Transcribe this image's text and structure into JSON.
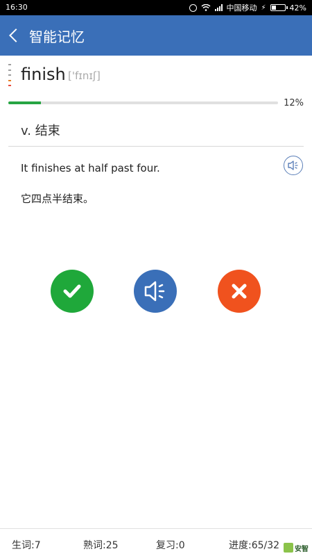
{
  "status_bar": {
    "time": "16:30",
    "carrier": "中国移动",
    "battery": "42%",
    "battery_level": 0.42
  },
  "header": {
    "title": "智能记忆",
    "background": "#3a6fb8"
  },
  "word": {
    "text": "finish",
    "phonetic": "['fɪnɪʃ]",
    "marks_colors": [
      "#9e9e9e",
      "#9e9e9e",
      "#9e9e9e",
      "#e67e22",
      "#e74c3c"
    ]
  },
  "progress": {
    "percent_label": "12%",
    "value": 0.12,
    "fill_color": "#27a543"
  },
  "definition": "v.  结束",
  "example": {
    "en": "It finishes at half past four.",
    "cn": "它四点半结束。"
  },
  "actions": {
    "know_icon": "check-icon",
    "speak_icon": "speaker-icon",
    "unknown_icon": "cross-icon",
    "know_color": "#1fa83a",
    "speak_color": "#3a6fb8",
    "unknown_color": "#f0521e"
  },
  "footer": {
    "new_words": "生词:7",
    "known_words": "熟词:25",
    "review": "复习:0",
    "progress": "进度:65/32"
  },
  "watermark": {
    "text": "安智"
  }
}
